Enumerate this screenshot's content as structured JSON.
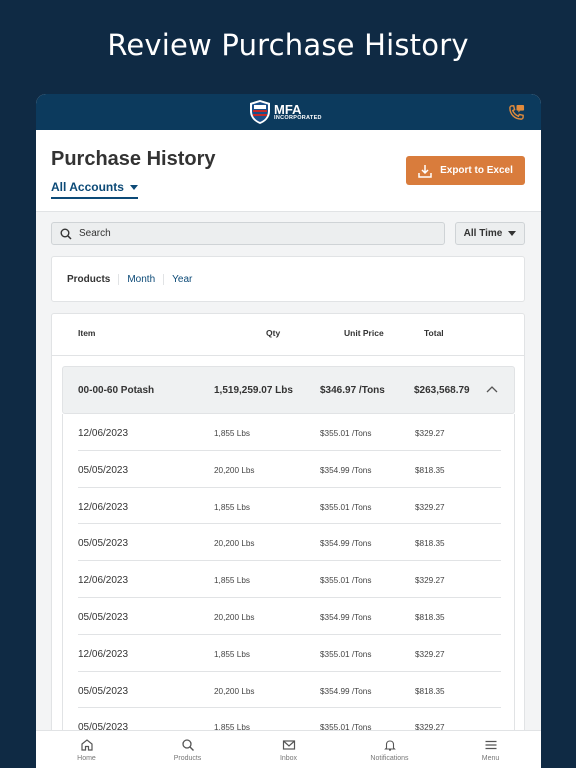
{
  "hero_title": "Review Purchase History",
  "header": {
    "logo_main": "MFA",
    "logo_sub": "INCORPORATED"
  },
  "page": {
    "title": "Purchase History",
    "account_selector": "All Accounts",
    "export_label": "Export to Excel",
    "search_placeholder": "Search",
    "time_filter": "All Time",
    "filters": [
      "Products",
      "Month",
      "Year"
    ],
    "active_filter": "Products"
  },
  "table": {
    "columns": {
      "item": "Item",
      "qty": "Qty",
      "unit_price": "Unit Price",
      "total": "Total"
    },
    "group": {
      "item": "00-00-60 Potash",
      "qty": "1,519,259.07 Lbs",
      "unit_price": "$346.97 /Tons",
      "total": "$263,568.79"
    },
    "rows": [
      {
        "date": "12/06/2023",
        "qty": "1,855 Lbs",
        "unit_price": "$355.01 /Tons",
        "total": "$329.27"
      },
      {
        "date": "05/05/2023",
        "qty": "20,200 Lbs",
        "unit_price": "$354.99 /Tons",
        "total": "$818.35"
      },
      {
        "date": "12/06/2023",
        "qty": "1,855 Lbs",
        "unit_price": "$355.01 /Tons",
        "total": "$329.27"
      },
      {
        "date": "05/05/2023",
        "qty": "20,200 Lbs",
        "unit_price": "$354.99 /Tons",
        "total": "$818.35"
      },
      {
        "date": "12/06/2023",
        "qty": "1,855 Lbs",
        "unit_price": "$355.01 /Tons",
        "total": "$329.27"
      },
      {
        "date": "05/05/2023",
        "qty": "20,200 Lbs",
        "unit_price": "$354.99 /Tons",
        "total": "$818.35"
      },
      {
        "date": "12/06/2023",
        "qty": "1,855 Lbs",
        "unit_price": "$355.01 /Tons",
        "total": "$329.27"
      },
      {
        "date": "05/05/2023",
        "qty": "20,200 Lbs",
        "unit_price": "$354.99 /Tons",
        "total": "$818.35"
      },
      {
        "date": "05/05/2023",
        "qty": "1,855 Lbs",
        "unit_price": "$355.01 /Tons",
        "total": "$329.27"
      }
    ]
  },
  "bottom_nav": [
    {
      "label": "Home",
      "icon": "home-icon"
    },
    {
      "label": "Products",
      "icon": "search-icon"
    },
    {
      "label": "Inbox",
      "icon": "mail-icon"
    },
    {
      "label": "Notifications",
      "icon": "bell-icon"
    },
    {
      "label": "Menu",
      "icon": "menu-icon"
    }
  ],
  "colors": {
    "background": "#0f2a44",
    "header": "#0c3a5d",
    "accent": "#d97c3c",
    "link": "#0c4a77"
  }
}
